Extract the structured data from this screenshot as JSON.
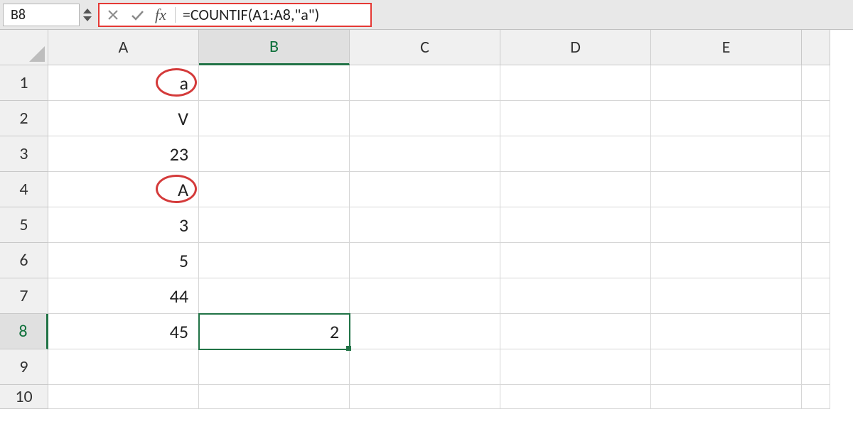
{
  "namebox": {
    "value": "B8"
  },
  "formula_bar": {
    "fx_label": "fx",
    "formula": "=COUNTIF(A1:A8,\"a\")"
  },
  "columns": [
    "A",
    "B",
    "C",
    "D",
    "E"
  ],
  "rows": [
    "1",
    "2",
    "3",
    "4",
    "5",
    "6",
    "7",
    "8",
    "9",
    "10"
  ],
  "cells": {
    "A1": "a",
    "A2": "V",
    "A3": "23",
    "A4": "A",
    "A5": "3",
    "A6": "5",
    "A7": "44",
    "A8": "45",
    "B8": "2"
  },
  "active": {
    "col": "B",
    "row": "8",
    "cell": "B8"
  },
  "circled": [
    "A1",
    "A4"
  ]
}
